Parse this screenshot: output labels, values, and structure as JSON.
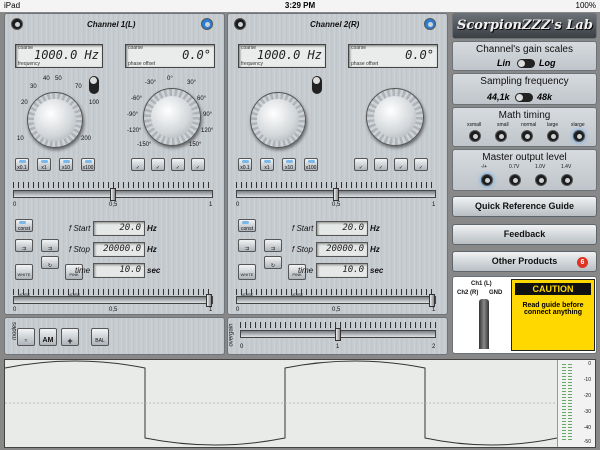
{
  "status": {
    "time": "3:29 PM",
    "device": "iPad",
    "battery": "100%"
  },
  "ch1": {
    "title": "Channel 1(L)",
    "freq_cap": "coarse",
    "freq_val": "1000.0 Hz",
    "freq_sub": "frequency",
    "ph_cap": "coarse",
    "ph_val": "0.0°",
    "ph_sub": "phase offset",
    "freq_scale": [
      "30",
      "40",
      "50",
      "70",
      "20",
      "100",
      "10",
      "200"
    ],
    "phase_scale": [
      "-30°",
      "0°",
      "30°",
      "-60°",
      "60°",
      "-90°",
      "90°",
      "-120°",
      "120°",
      "-150°",
      "150°"
    ],
    "mult": [
      "x0.1",
      "x1",
      "x10",
      "x100"
    ],
    "sl_labels": [
      "0",
      "0,5",
      "1"
    ],
    "fstart_l": "f Start",
    "fstart_v": "20.0",
    "fstart_u": "Hz",
    "fstop_l": "f Stop",
    "fstop_v": "20000.0",
    "fstop_u": "Hz",
    "time_l": "time",
    "time_v": "10.0",
    "time_u": "sec",
    "sweep_btns": [
      "const",
      "WHITE NOISE",
      "PINK NOISE"
    ]
  },
  "ch2": {
    "title": "Channel 2(R)",
    "freq_cap": "coarse",
    "freq_val": "1000.0 Hz",
    "freq_sub": "frequency",
    "ph_cap": "coarse",
    "ph_val": "0.0°",
    "ph_sub": "phase offset",
    "freq_scale": [
      "30",
      "40",
      "50",
      "70",
      "20",
      "100",
      "10",
      "200"
    ],
    "phase_scale": [
      "-30°",
      "0°",
      "30°",
      "-60°",
      "60°",
      "-90°",
      "90°",
      "-120°",
      "120°",
      "-150°",
      "150°"
    ],
    "mult": [
      "x0.1",
      "x1",
      "x10",
      "x100"
    ],
    "sl_labels": [
      "0",
      "0,5",
      "1"
    ],
    "fstart_l": "f Start",
    "fstart_v": "20.0",
    "fstart_u": "Hz",
    "fstop_l": "f Stop",
    "fstop_v": "20000.0",
    "fstop_u": "Hz",
    "time_l": "time",
    "time_v": "10.0",
    "time_u": "sec",
    "sweep_btns": [
      "const",
      "WHITE NOISE",
      "PINK NOISE"
    ]
  },
  "modes": {
    "label": "modes",
    "am": "AM",
    "plus": "+",
    "bal": "BAL"
  },
  "overgain": {
    "label": "overgain",
    "ticks": [
      "0",
      "1",
      "2"
    ]
  },
  "right": {
    "brand": "ScorpionZZZ's Lab",
    "gain": {
      "title": "Channel's gain scales",
      "lin": "Lin",
      "log": "Log"
    },
    "sampling": {
      "title": "Sampling frequency",
      "a": "44,1k",
      "b": "48k"
    },
    "timing": {
      "title": "Math timing",
      "opts": [
        "xsmall",
        "small",
        "normal",
        "large",
        "xlarge"
      ]
    },
    "master": {
      "title": "Master output level",
      "opts": [
        "-/+",
        "0.7V",
        "1.0V",
        "1.4V"
      ]
    },
    "btn_quick": "Quick Reference Guide",
    "btn_feedback": "Feedback",
    "btn_other": "Other Products",
    "other_badge": "6",
    "jack": {
      "ch1": "Ch1 (L)",
      "ch2": "Ch2 (R)",
      "gnd": "GND"
    },
    "caution": {
      "title": "CAUTION",
      "text": "Read guide before connect anything"
    }
  },
  "meter": {
    "ticks": [
      "0",
      "-10",
      "-20",
      "-30",
      "-40",
      "-50"
    ]
  }
}
